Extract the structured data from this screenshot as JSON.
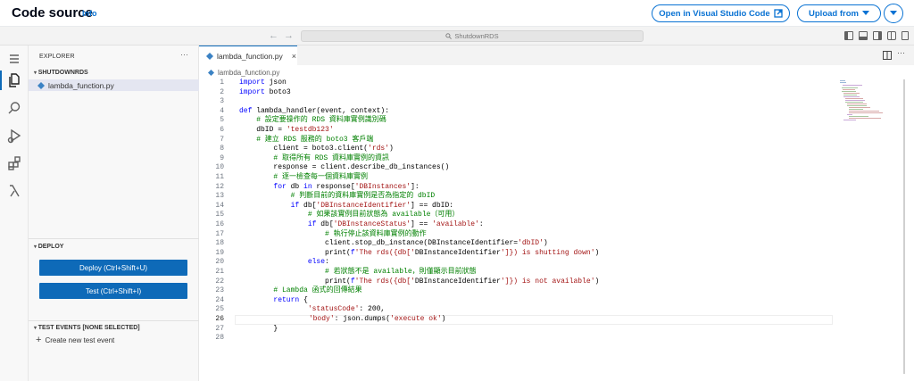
{
  "header": {
    "title": "Code source",
    "info": "Info",
    "open_vscode": "Open in Visual Studio Code",
    "upload_from": "Upload from"
  },
  "titlebar": {
    "back": "←",
    "forward": "→",
    "search_text": "ShutdownRDS"
  },
  "explorer": {
    "header": "EXPLORER",
    "more": "···",
    "folder": "SHUTDOWNRDS",
    "file": "lambda_function.py"
  },
  "deploy": {
    "header": "DEPLOY",
    "deploy_button": "Deploy (Ctrl+Shift+U)",
    "test_button": "Test (Ctrl+Shift+I)"
  },
  "test_events": {
    "header": "TEST EVENTS [NONE SELECTED]",
    "create": "Create new test event"
  },
  "editor": {
    "tab_label": "lambda_function.py",
    "breadcrumb": "lambda_function.py",
    "current_line": 26,
    "lines": [
      "import json",
      "import boto3",
      "",
      "def lambda_handler(event, context):",
      "    # 設定要操作的 RDS 資料庫實例識別碼",
      "    dbID = 'testdb123'",
      "    # 建立 RDS 服務的 boto3 客戶端",
      "        client = boto3.client('rds')",
      "        # 取得所有 RDS 資料庫實例的資訊",
      "        response = client.describe_db_instances()",
      "        # 逐一檢查每一個資料庫實例",
      "        for db in response['DBInstances']:",
      "            # 判斷目前的資料庫實例是否為指定的 dbID",
      "            if db['DBInstanceIdentifier'] == dbID:",
      "                # 如果該實例目前狀態為 available（可用）",
      "                if db['DBInstanceStatus'] == 'available':",
      "                    # 執行停止該資料庫實例的動作",
      "                    client.stop_db_instance(DBInstanceIdentifier='dbID')",
      "                    print(f'The rds({db['DBInstanceIdentifier']}) is shutting down')",
      "                else:",
      "                    # 若狀態不是 available，則僅顯示目前狀態",
      "                    print(f'The rds({db['DBInstanceIdentifier']}) is not available')",
      "        # Lambda 函式的回傳結果",
      "        return {",
      "                'statusCode': 200,",
      "                'body': json.dumps('execute ok')",
      "        }",
      ""
    ]
  }
}
